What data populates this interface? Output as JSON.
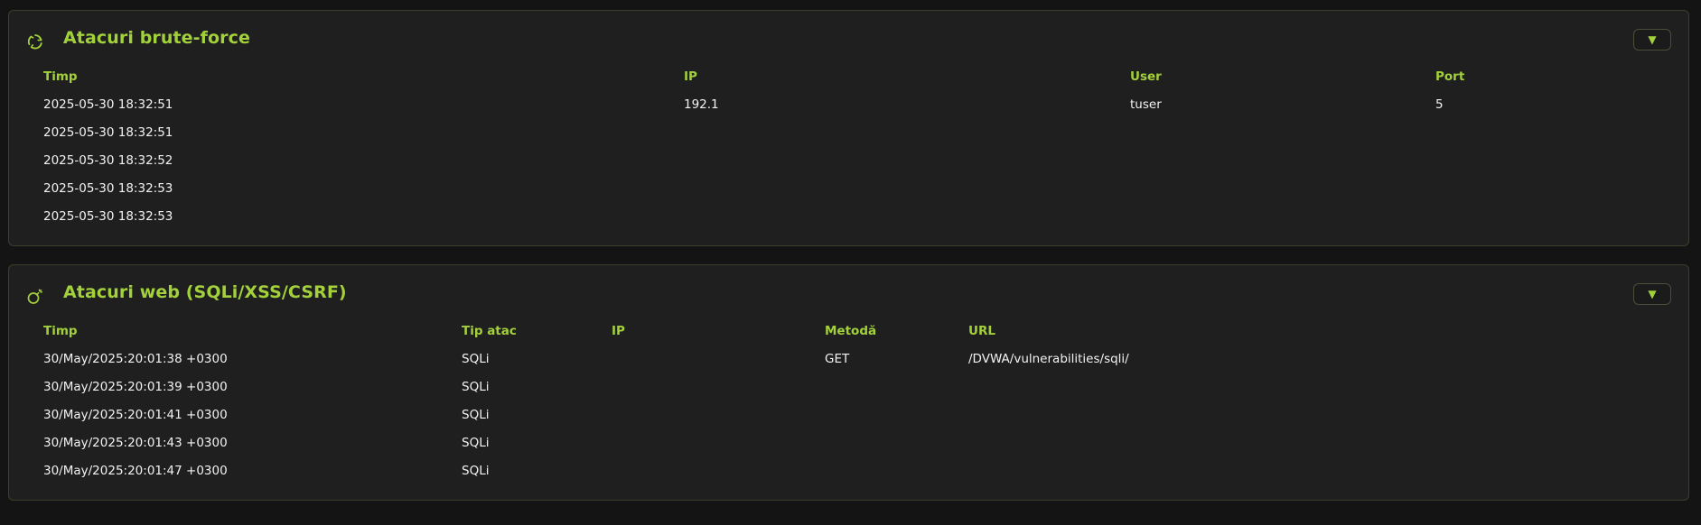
{
  "brute_force": {
    "title": "Atacuri brute-force",
    "toggle": "▼",
    "columns": [
      "Timp",
      "IP",
      "User",
      "Port"
    ],
    "rows": [
      {
        "time": "2025-05-30 18:32:51",
        "ip": "192.1",
        "user": "tuser",
        "port": "5"
      },
      {
        "time": "2025-05-30 18:32:51",
        "ip": "",
        "user": "",
        "port": ""
      },
      {
        "time": "2025-05-30 18:32:52",
        "ip": "",
        "user": "",
        "port": ""
      },
      {
        "time": "2025-05-30 18:32:53",
        "ip": "",
        "user": "",
        "port": ""
      },
      {
        "time": "2025-05-30 18:32:53",
        "ip": "",
        "user": "",
        "port": ""
      }
    ]
  },
  "web_attacks": {
    "title": "Atacuri web (SQLi/XSS/CSRF)",
    "toggle": "▼",
    "columns": [
      "Timp",
      "Tip atac",
      "IP",
      "Metodă",
      "URL"
    ],
    "rows": [
      {
        "time": "30/May/2025:20:01:38 +0300",
        "type": "SQLi",
        "ip": "",
        "method": "GET",
        "url": "/DVWA/vulnerabilities/sqli/"
      },
      {
        "time": "30/May/2025:20:01:39 +0300",
        "type": "SQLi",
        "ip": "",
        "method": "",
        "url": ""
      },
      {
        "time": "30/May/2025:20:01:41 +0300",
        "type": "SQLi",
        "ip": "",
        "method": "",
        "url": ""
      },
      {
        "time": "30/May/2025:20:01:43 +0300",
        "type": "SQLi",
        "ip": "",
        "method": "",
        "url": ""
      },
      {
        "time": "30/May/2025:20:01:47 +0300",
        "type": "SQLi",
        "ip": "",
        "method": "",
        "url": ""
      }
    ]
  },
  "colors": {
    "accent": "#a3d13b",
    "background": "#141414",
    "panel": "#1f1f1f"
  },
  "icons": {
    "brute_force": "refresh-shield-icon",
    "web_attacks": "bomb-icon"
  }
}
